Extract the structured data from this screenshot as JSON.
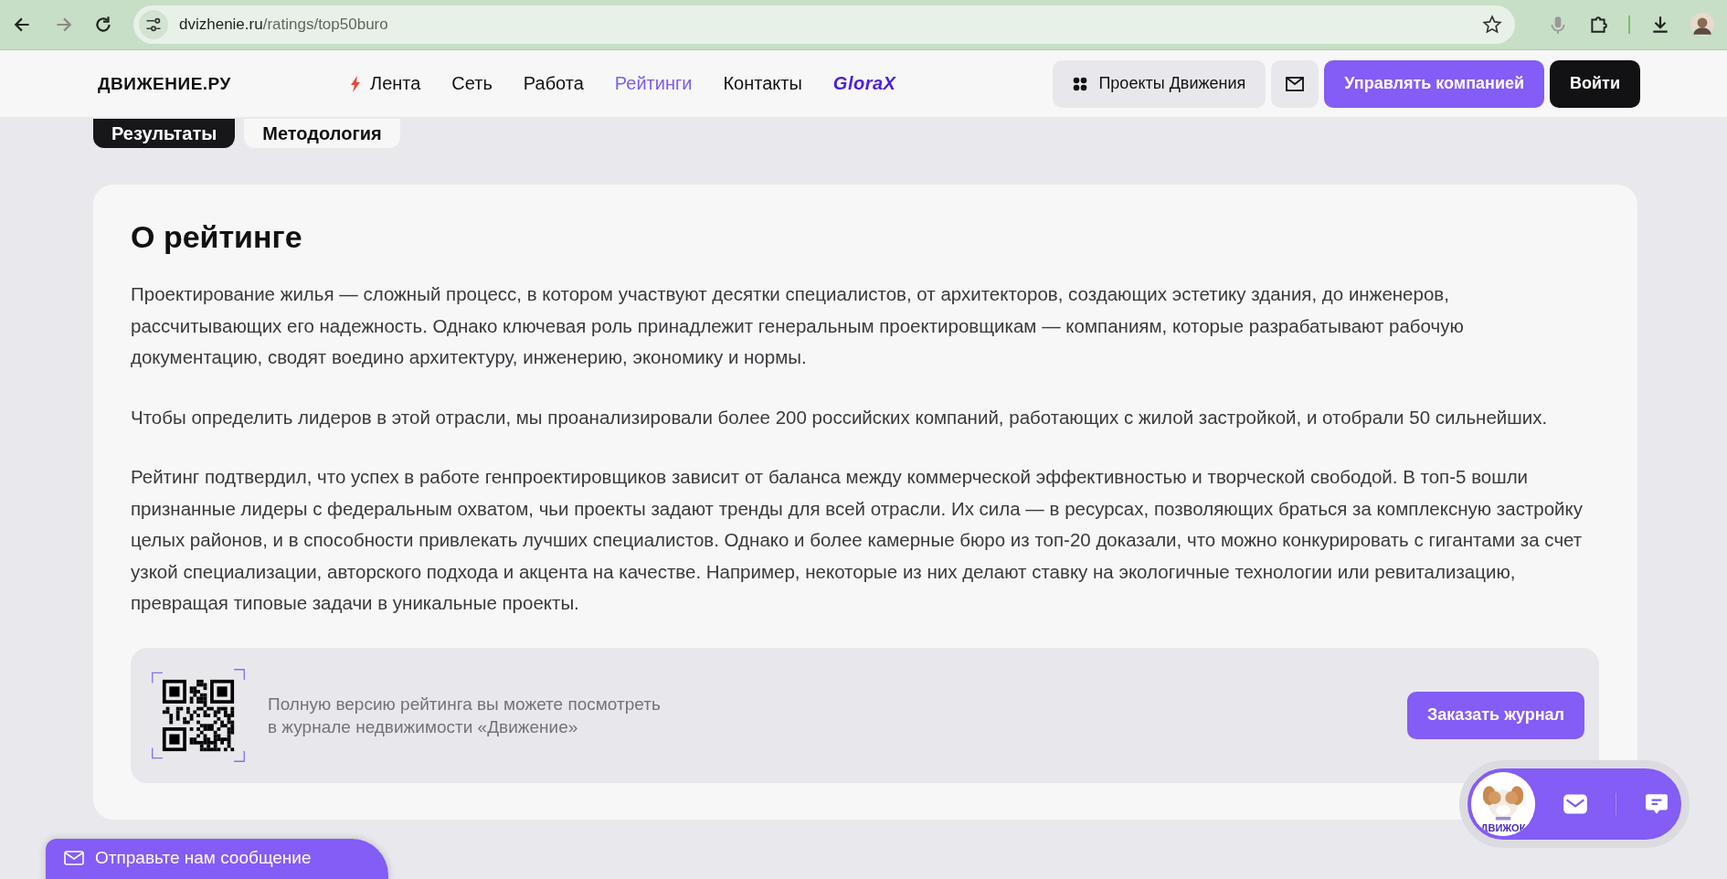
{
  "browser": {
    "url_host": "dvizhenie.ru",
    "url_path": "/ratings/top50buro"
  },
  "header": {
    "logo": "ДВИЖЕНИЕ.РУ",
    "nav": [
      {
        "label": "Лента",
        "kind": "flash",
        "selected": false
      },
      {
        "label": "Сеть",
        "kind": "plain",
        "selected": false
      },
      {
        "label": "Работа",
        "kind": "plain",
        "selected": false
      },
      {
        "label": "Рейтинги",
        "kind": "plain",
        "selected": true
      },
      {
        "label": "Контакты",
        "kind": "plain",
        "selected": false
      },
      {
        "label": "GloraX",
        "kind": "brand",
        "selected": false
      }
    ],
    "projects_button": "Проекты Движения",
    "manage_button": "Управлять компанией",
    "login_button": "Войти"
  },
  "tabs": [
    {
      "label": "Результаты",
      "selected": true
    },
    {
      "label": "Методология",
      "selected": false
    }
  ],
  "about": {
    "title": "О рейтинге",
    "paragraphs": [
      "Проектирование жилья — сложный процесс, в котором участвуют десятки специалистов, от архитекторов, создающих эстетику здания, до инженеров, рассчитывающих его надежность. Однако ключевая роль принадлежит генеральным проектировщикам — компаниям, которые разрабатывают рабочую документацию, сводят воедино архитектуру, инженерию, экономику и нормы.",
      "Чтобы определить лидеров в этой отрасли, мы проанализировали более 200 российских компаний, работающих с жилой застройкой, и отобрали 50 сильнейших.",
      "Рейтинг подтвердил, что успех в работе генпроектировщиков зависит от баланса между коммерческой эффективностью и творческой свободой. В топ-5 вошли признанные лидеры с федеральным охватом, чьи проекты задают тренды для всей отрасли. Их сила — в ресурсах, позволяющих браться за комплексную застройку целых районов, и в способности привлекать лучших специалистов. Однако и более камерные бюро из топ-20 доказали, что можно конкурировать с гигантами за счет узкой специализации, авторского подхода и акцента на качестве. Например, некоторые из них делают ставку на экологичные технологии или ревитализацию, превращая типовые задачи в уникальные проекты."
    ],
    "promo": {
      "lines": [
        "Полную версию рейтинга вы можете посмотреть",
        "в журнале недвижимости «Движение»"
      ],
      "button": "Заказать журнал"
    }
  },
  "chat_widget": {
    "mascot_label": "ДВИЖОК"
  },
  "feedback_tab": {
    "label": "Отправьте нам сообщение"
  }
}
